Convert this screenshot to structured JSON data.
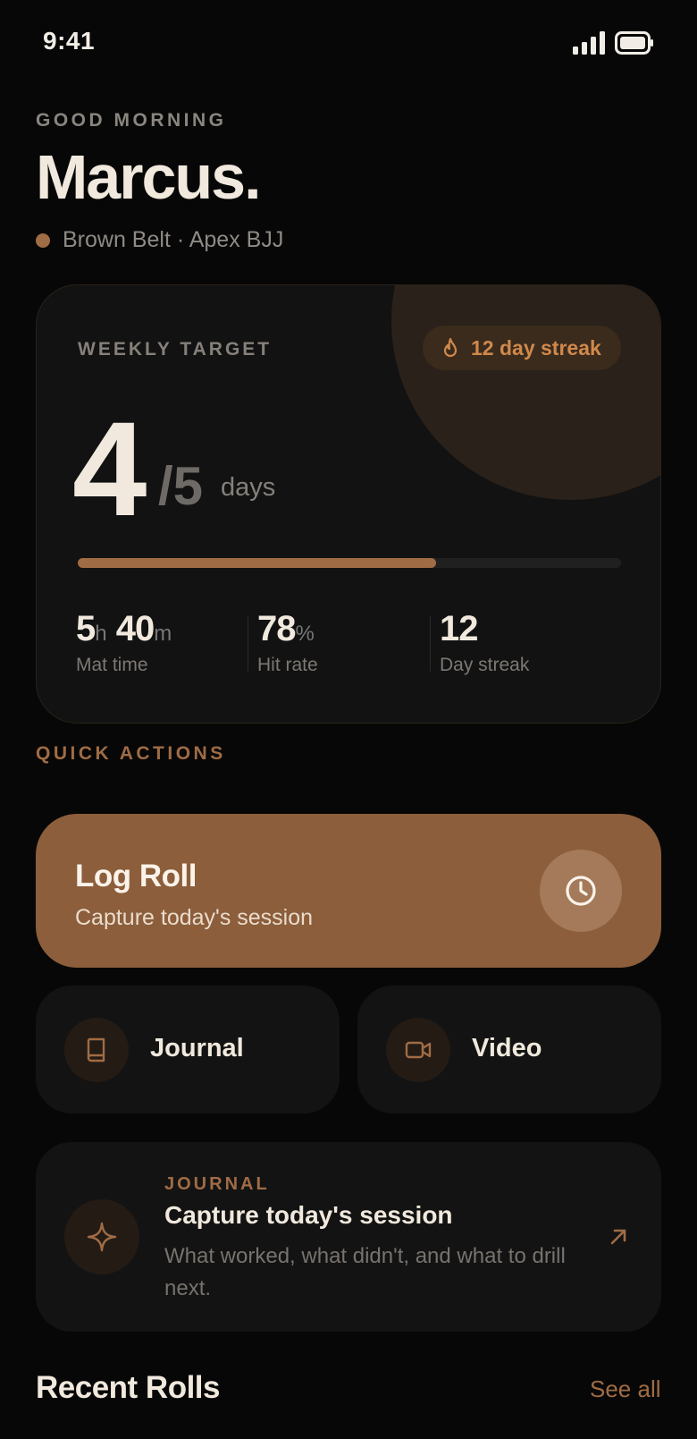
{
  "status_bar": {
    "time": "9:41"
  },
  "header": {
    "greeting": "GOOD MORNING",
    "name": "Marcus.",
    "belt_info": "Brown Belt · Apex BJJ"
  },
  "weekly_target": {
    "label": "WEEKLY TARGET",
    "streak_badge": "12 day streak",
    "days_done": "4",
    "days_total": "/5",
    "unit": "days",
    "progress_fraction": 0.66,
    "stats": {
      "mat_time": {
        "hours": "5",
        "hours_unit": "h",
        "minutes": "40",
        "minutes_unit": "m",
        "label": "Mat time"
      },
      "hit_rate": {
        "value": "78",
        "unit": "%",
        "label": "Hit rate"
      },
      "day_streak": {
        "value": "12",
        "label": "Day streak"
      }
    }
  },
  "quick_actions": {
    "label": "QUICK ACTIONS",
    "log_roll": {
      "title": "Log Roll",
      "subtitle": "Capture today's session"
    },
    "journal": {
      "label": "Journal"
    },
    "video": {
      "label": "Video"
    }
  },
  "journal_prompt": {
    "eyebrow": "JOURNAL",
    "title": "Capture today's session",
    "description": "What worked, what didn't, and what to drill next."
  },
  "recent_rolls": {
    "title": "Recent Rolls",
    "see_all": "See all"
  },
  "colors": {
    "accent": "#a06c45",
    "background": "#070707",
    "card": "#131313",
    "log_roll": "#8c5e3b"
  },
  "icons": [
    "signal-icon",
    "battery-icon",
    "flame-icon",
    "clock-icon",
    "book-icon",
    "video-icon",
    "sparkle-icon",
    "arrow-up-right-icon"
  ]
}
